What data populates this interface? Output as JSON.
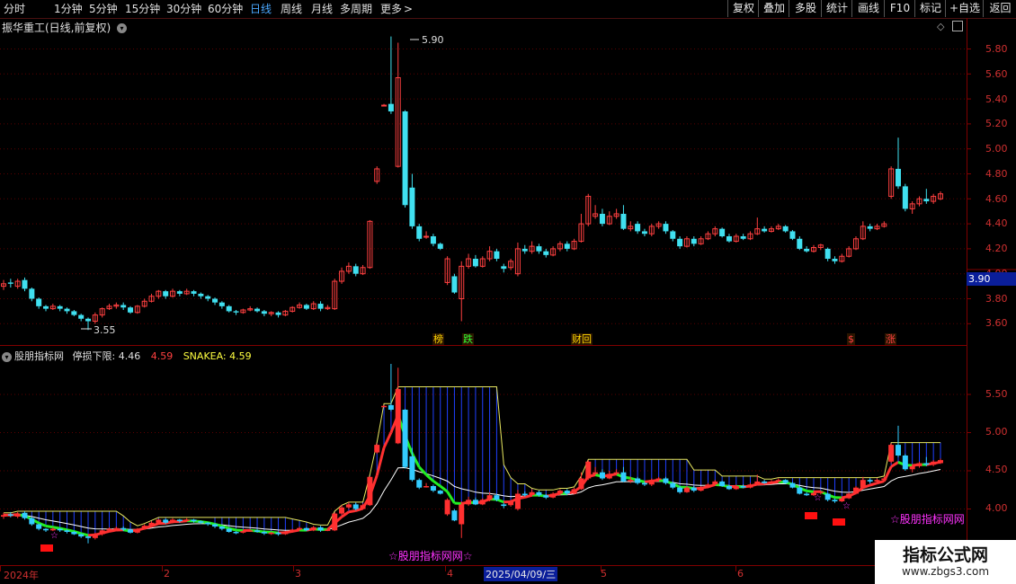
{
  "toolbar": {
    "periods": [
      "分时",
      "1分钟",
      "5分钟",
      "15分钟",
      "30分钟",
      "60分钟",
      "日线",
      "周线",
      "月线",
      "多周期",
      "更多"
    ],
    "active_period": "日线",
    "more_chevron": ">",
    "right_buttons": [
      "复权",
      "叠加",
      "多股",
      "统计",
      "画线",
      "F10",
      "标记",
      "+自选",
      "返回"
    ]
  },
  "main_chart": {
    "title": "振华重工(日线,前复权)",
    "y_ticks": [
      "5.80",
      "5.60",
      "5.40",
      "5.20",
      "5.00",
      "4.80",
      "4.60",
      "4.40",
      "4.20",
      "4.00",
      "3.80",
      "3.60"
    ],
    "current_price": "3.90",
    "high_label": "5.90",
    "low_label": "3.55",
    "badges": [
      {
        "text": "榜",
        "color": "#ffd700"
      },
      {
        "text": "跌",
        "color": "#33ff33"
      },
      {
        "text": "财回",
        "color": "#ffd700"
      },
      {
        "text": "$",
        "color": "#ff4040"
      },
      {
        "text": "涨",
        "color": "#ff4040"
      }
    ]
  },
  "indicator": {
    "name": "股朋指标网",
    "stop_label": "停损下限: 4.46",
    "value2": "4.59",
    "snake_label": "SNAKEA: 4.59",
    "y_ticks": [
      "5.50",
      "5.00",
      "4.50",
      "4.00"
    ],
    "watermarks": [
      "☆股朋指标网网☆",
      "☆股朋指标网网"
    ]
  },
  "x_axis": {
    "labels": [
      "2024年",
      "2",
      "3",
      "4",
      "2025/04/09/三",
      "5",
      "6"
    ]
  },
  "logo": {
    "name": "指标公式网",
    "url": "www.zbgs3.com"
  },
  "colors": {
    "up": "#ff4040",
    "down": "#40e0f0",
    "axis": "#800000",
    "grid": "#5a0000"
  },
  "chart_data": {
    "type": "candlestick",
    "title": "振华重工(日线,前复权)",
    "ylim": [
      3.5,
      5.95
    ],
    "candles": [
      [
        3.9,
        3.92,
        3.95,
        3.87
      ],
      [
        3.93,
        3.92,
        3.96,
        3.89
      ],
      [
        3.9,
        3.94,
        3.96,
        3.88
      ],
      [
        3.95,
        3.88,
        3.97,
        3.86
      ],
      [
        3.88,
        3.8,
        3.89,
        3.78
      ],
      [
        3.8,
        3.74,
        3.81,
        3.72
      ],
      [
        3.74,
        3.72,
        3.75,
        3.7
      ],
      [
        3.72,
        3.74,
        3.76,
        3.71
      ],
      [
        3.74,
        3.72,
        3.75,
        3.7
      ],
      [
        3.72,
        3.7,
        3.73,
        3.68
      ],
      [
        3.7,
        3.67,
        3.71,
        3.66
      ],
      [
        3.67,
        3.64,
        3.68,
        3.62
      ],
      [
        3.64,
        3.62,
        3.65,
        3.55
      ],
      [
        3.62,
        3.67,
        3.69,
        3.6
      ],
      [
        3.67,
        3.72,
        3.73,
        3.65
      ],
      [
        3.72,
        3.74,
        3.76,
        3.71
      ],
      [
        3.74,
        3.75,
        3.77,
        3.72
      ],
      [
        3.75,
        3.73,
        3.77,
        3.71
      ],
      [
        3.73,
        3.69,
        3.74,
        3.68
      ],
      [
        3.69,
        3.74,
        3.75,
        3.68
      ],
      [
        3.74,
        3.78,
        3.8,
        3.73
      ],
      [
        3.78,
        3.82,
        3.84,
        3.77
      ],
      [
        3.82,
        3.86,
        3.87,
        3.8
      ],
      [
        3.86,
        3.82,
        3.87,
        3.8
      ],
      [
        3.82,
        3.86,
        3.88,
        3.81
      ],
      [
        3.86,
        3.84,
        3.87,
        3.82
      ],
      [
        3.84,
        3.86,
        3.88,
        3.83
      ],
      [
        3.86,
        3.84,
        3.87,
        3.82
      ],
      [
        3.84,
        3.82,
        3.85,
        3.8
      ],
      [
        3.82,
        3.8,
        3.83,
        3.78
      ],
      [
        3.8,
        3.77,
        3.81,
        3.75
      ],
      [
        3.77,
        3.74,
        3.78,
        3.72
      ],
      [
        3.74,
        3.7,
        3.75,
        3.69
      ],
      [
        3.7,
        3.69,
        3.71,
        3.67
      ],
      [
        3.69,
        3.71,
        3.72,
        3.68
      ],
      [
        3.71,
        3.72,
        3.74,
        3.7
      ],
      [
        3.72,
        3.7,
        3.73,
        3.69
      ],
      [
        3.7,
        3.68,
        3.71,
        3.66
      ],
      [
        3.68,
        3.69,
        3.7,
        3.66
      ],
      [
        3.69,
        3.67,
        3.7,
        3.65
      ],
      [
        3.67,
        3.7,
        3.71,
        3.66
      ],
      [
        3.7,
        3.73,
        3.74,
        3.69
      ],
      [
        3.73,
        3.75,
        3.77,
        3.72
      ],
      [
        3.75,
        3.72,
        3.76,
        3.71
      ],
      [
        3.72,
        3.76,
        3.78,
        3.71
      ],
      [
        3.76,
        3.72,
        3.78,
        3.7
      ],
      [
        3.72,
        3.73,
        3.75,
        3.71
      ],
      [
        3.72,
        3.94,
        3.96,
        3.71
      ],
      [
        3.94,
        4.02,
        4.05,
        3.92
      ],
      [
        4.02,
        4.06,
        4.09,
        4.0
      ],
      [
        4.06,
        4.0,
        4.08,
        3.98
      ],
      [
        4.0,
        4.05,
        4.07,
        3.99
      ],
      [
        4.05,
        4.42,
        4.43,
        4.04
      ],
      [
        4.74,
        4.84,
        4.86,
        4.72
      ],
      [
        5.35,
        5.35,
        5.36,
        5.34
      ],
      [
        5.36,
        5.3,
        5.9,
        5.28
      ],
      [
        4.86,
        5.57,
        5.85,
        4.85
      ],
      [
        5.3,
        4.55,
        5.31,
        4.53
      ],
      [
        4.69,
        4.38,
        4.8,
        4.36
      ],
      [
        4.38,
        4.28,
        4.4,
        4.26
      ],
      [
        4.3,
        4.3,
        4.34,
        4.28
      ],
      [
        4.3,
        4.24,
        4.32,
        4.22
      ],
      [
        4.24,
        4.2,
        4.25,
        4.19
      ],
      [
        3.93,
        4.12,
        4.14,
        3.91
      ],
      [
        3.98,
        3.85,
        4.0,
        3.84
      ],
      [
        3.8,
        4.06,
        4.1,
        3.62
      ],
      [
        4.06,
        4.12,
        4.16,
        4.04
      ],
      [
        4.12,
        4.06,
        4.15,
        4.05
      ],
      [
        4.06,
        4.12,
        4.14,
        4.05
      ],
      [
        4.12,
        4.18,
        4.22,
        4.1
      ],
      [
        4.18,
        4.12,
        4.2,
        4.1
      ],
      [
        4.06,
        4.04,
        4.08,
        4.01
      ],
      [
        4.05,
        4.1,
        4.12,
        4.03
      ],
      [
        4.0,
        4.2,
        4.25,
        3.98
      ],
      [
        4.2,
        4.18,
        4.23,
        4.16
      ],
      [
        4.18,
        4.22,
        4.26,
        4.16
      ],
      [
        4.22,
        4.18,
        4.24,
        4.16
      ],
      [
        4.18,
        4.15,
        4.2,
        4.13
      ],
      [
        4.15,
        4.2,
        4.22,
        4.14
      ],
      [
        4.2,
        4.24,
        4.26,
        4.18
      ],
      [
        4.24,
        4.2,
        4.26,
        4.18
      ],
      [
        4.2,
        4.26,
        4.28,
        4.19
      ],
      [
        4.26,
        4.4,
        4.48,
        4.25
      ],
      [
        4.4,
        4.62,
        4.64,
        4.38
      ],
      [
        4.46,
        4.48,
        4.55,
        4.44
      ],
      [
        4.48,
        4.4,
        4.52,
        4.38
      ],
      [
        4.4,
        4.46,
        4.5,
        4.39
      ],
      [
        4.46,
        4.48,
        4.52,
        4.44
      ],
      [
        4.48,
        4.36,
        4.55,
        4.35
      ],
      [
        4.36,
        4.38,
        4.42,
        4.34
      ],
      [
        4.4,
        4.34,
        4.42,
        4.32
      ],
      [
        4.34,
        4.32,
        4.36,
        4.3
      ],
      [
        4.32,
        4.38,
        4.4,
        4.3
      ],
      [
        4.38,
        4.4,
        4.42,
        4.36
      ],
      [
        4.4,
        4.34,
        4.42,
        4.32
      ],
      [
        4.34,
        4.28,
        4.35,
        4.26
      ],
      [
        4.28,
        4.22,
        4.3,
        4.2
      ],
      [
        4.22,
        4.28,
        4.3,
        4.21
      ],
      [
        4.28,
        4.24,
        4.3,
        4.22
      ],
      [
        4.24,
        4.28,
        4.3,
        4.23
      ],
      [
        4.28,
        4.32,
        4.34,
        4.27
      ],
      [
        4.32,
        4.36,
        4.38,
        4.3
      ],
      [
        4.36,
        4.3,
        4.37,
        4.29
      ],
      [
        4.3,
        4.26,
        4.32,
        4.25
      ],
      [
        4.26,
        4.3,
        4.32,
        4.25
      ],
      [
        4.3,
        4.28,
        4.32,
        4.27
      ],
      [
        4.28,
        4.32,
        4.34,
        4.27
      ],
      [
        4.32,
        4.36,
        4.45,
        4.31
      ],
      [
        4.36,
        4.34,
        4.38,
        4.33
      ],
      [
        4.34,
        4.36,
        4.38,
        4.33
      ],
      [
        4.36,
        4.38,
        4.4,
        4.35
      ],
      [
        4.38,
        4.34,
        4.39,
        4.33
      ],
      [
        4.34,
        4.28,
        4.35,
        4.27
      ],
      [
        4.28,
        4.2,
        4.3,
        4.19
      ],
      [
        4.2,
        4.18,
        4.22,
        4.17
      ],
      [
        4.18,
        4.21,
        4.23,
        4.17
      ],
      [
        4.21,
        4.23,
        4.24,
        4.19
      ],
      [
        4.2,
        4.12,
        4.21,
        4.1
      ],
      [
        4.12,
        4.1,
        4.14,
        4.08
      ],
      [
        4.1,
        4.14,
        4.16,
        4.09
      ],
      [
        4.14,
        4.2,
        4.22,
        4.13
      ],
      [
        4.2,
        4.28,
        4.3,
        4.19
      ],
      [
        4.28,
        4.38,
        4.42,
        4.27
      ],
      [
        4.38,
        4.36,
        4.4,
        4.34
      ],
      [
        4.36,
        4.38,
        4.4,
        4.35
      ],
      [
        4.38,
        4.4,
        4.42,
        4.37
      ],
      [
        4.62,
        4.84,
        4.86,
        4.6
      ],
      [
        4.84,
        4.7,
        5.09,
        4.68
      ],
      [
        4.7,
        4.52,
        4.72,
        4.5
      ],
      [
        4.52,
        4.56,
        4.58,
        4.48
      ],
      [
        4.56,
        4.6,
        4.62,
        4.54
      ],
      [
        4.6,
        4.58,
        4.68,
        4.56
      ],
      [
        4.58,
        4.62,
        4.64,
        4.56
      ],
      [
        4.6,
        4.64,
        4.66,
        4.59
      ]
    ],
    "indicator": {
      "name": "股朋指标网",
      "ylim": [
        3.7,
        5.95
      ],
      "stop_lower": 4.46,
      "snakea": 4.59
    },
    "x_labels": [
      "2024年",
      "2",
      "3",
      "4",
      "2025/04/09/三",
      "5",
      "6"
    ]
  }
}
